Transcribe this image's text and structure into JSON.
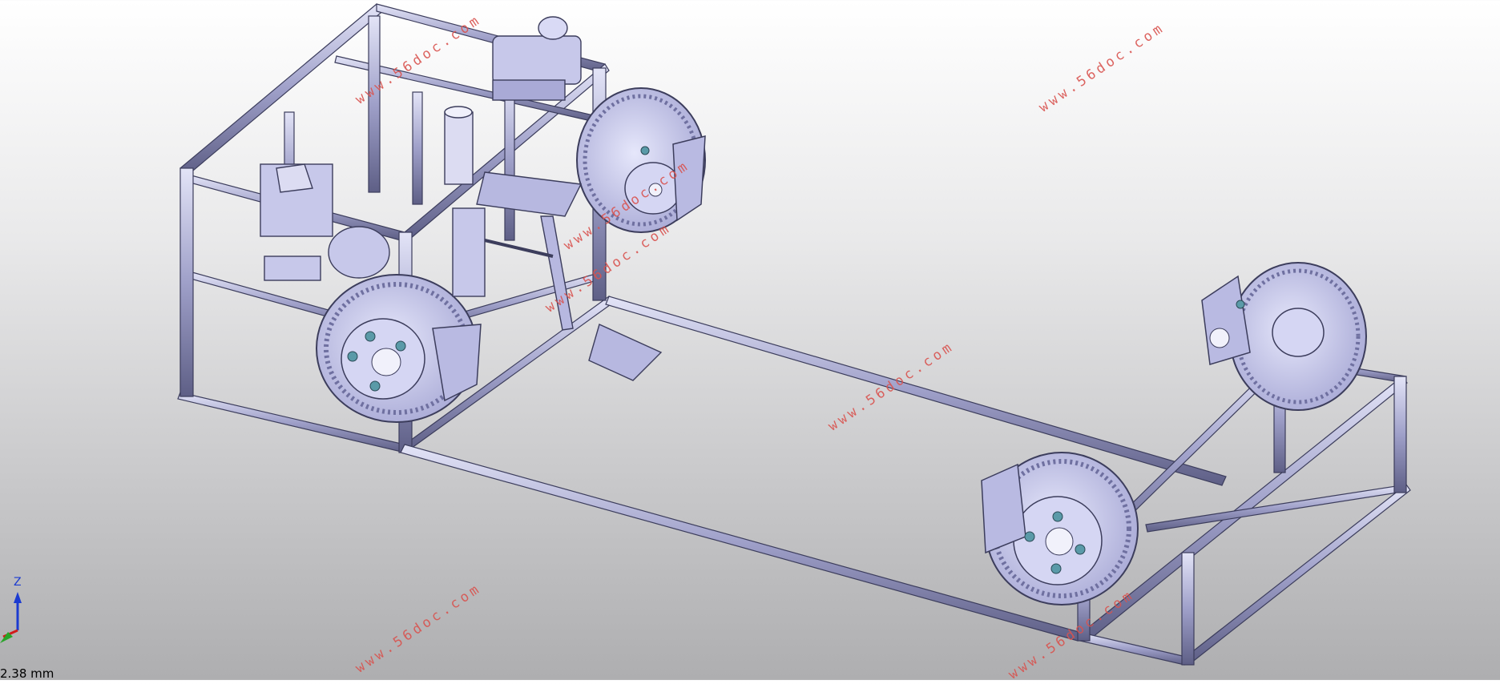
{
  "watermarks": [
    "www.56doc.com",
    "www.56doc.com",
    "www.56doc.com",
    "www.56doc.com",
    "www.56doc.com",
    "www.56doc.com",
    "www.56doc.com"
  ],
  "triad": {
    "z_label": "Z"
  },
  "scale_readout": "2.38 mm",
  "colors": {
    "frame": "#8e8fb6",
    "frame_light": "#c7c8e8",
    "frame_dark": "#4b4c6e",
    "disc": "#c3c4ec",
    "bolt": "#5a9aa8",
    "watermark": "#d9534f"
  }
}
